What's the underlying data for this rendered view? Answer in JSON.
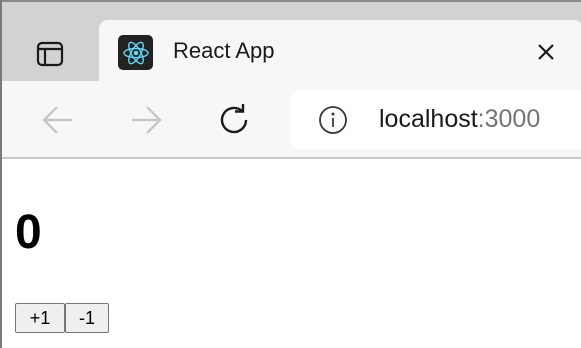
{
  "browser": {
    "tab": {
      "title": "React App",
      "favicon": "react-logo-icon",
      "close_icon": "close-icon"
    },
    "tab_actions_icon": "tab-actions-icon",
    "toolbar": {
      "back_icon": "back-arrow-icon",
      "forward_icon": "forward-arrow-icon",
      "reload_icon": "reload-icon"
    },
    "address_bar": {
      "info_icon": "info-icon",
      "host": "localhost",
      "port": ":3000"
    }
  },
  "page": {
    "count": "0",
    "increment_label": "+1",
    "decrement_label": "-1"
  },
  "colors": {
    "tabstrip_bg": "#d2d2d2",
    "toolbar_bg": "#f7f7f7",
    "favicon_bg": "#222222",
    "react_accent": "#61dafb",
    "disabled_icon": "#c4c4c4"
  }
}
